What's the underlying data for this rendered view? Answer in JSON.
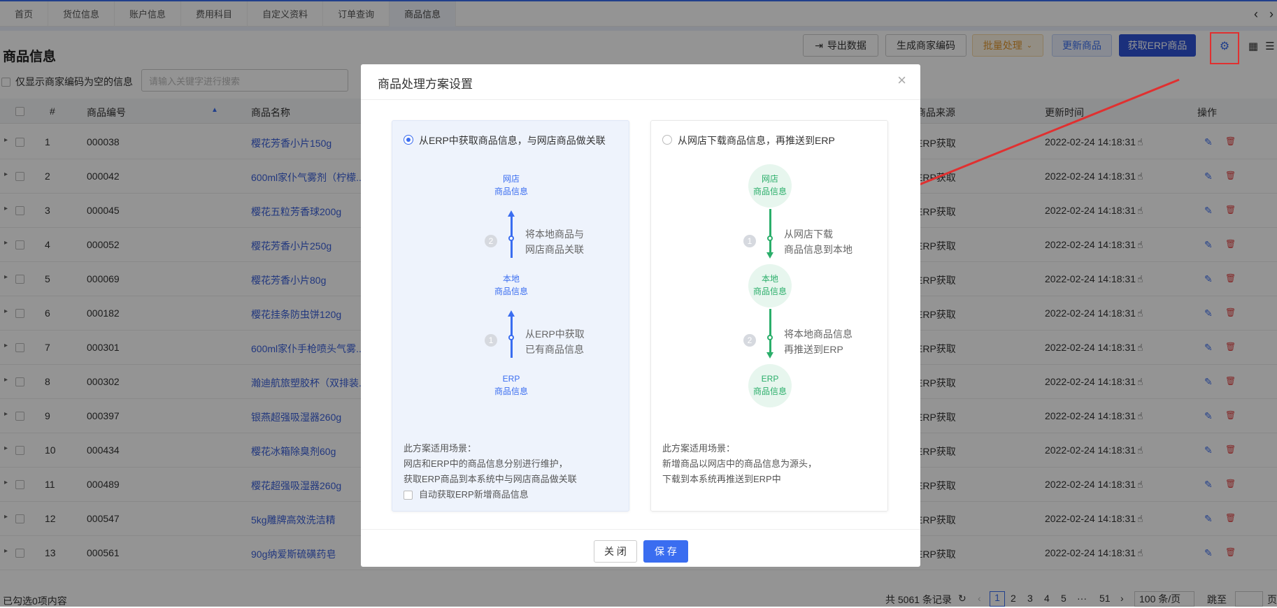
{
  "tabs": [
    "首页",
    "货位信息",
    "账户信息",
    "费用科目",
    "自定义资料",
    "订单查询",
    "商品信息"
  ],
  "active_tab": "商品信息",
  "page_title": "商品信息",
  "toolbar": {
    "export_label": "导出数据",
    "gen_code_label": "生成商家编码",
    "batch_label": "批量处理",
    "update_label": "更新商品",
    "fetch_erp_label": "获取ERP商品"
  },
  "filter": {
    "only_empty_label": "仅显示商家编码为空的信息",
    "search_placeholder": "请输入关键字进行搜索"
  },
  "table": {
    "headers": {
      "no": "#",
      "code": "商品编号",
      "name": "商品名称",
      "source": "商品来源",
      "time": "更新时间",
      "ops": "操作"
    },
    "rows": [
      {
        "no": "1",
        "code": "000038",
        "name": "樱花芳香小片150g",
        "source": "ERP获取",
        "time": "2022-02-24 14:18:31"
      },
      {
        "no": "2",
        "code": "000042",
        "name": "600ml家仆气雾剂（柠檬...",
        "source": "ERP获取",
        "time": "2022-02-24 14:18:31"
      },
      {
        "no": "3",
        "code": "000045",
        "name": "樱花五粒芳香球200g",
        "source": "ERP获取",
        "time": "2022-02-24 14:18:31"
      },
      {
        "no": "4",
        "code": "000052",
        "name": "樱花芳香小片250g",
        "source": "ERP获取",
        "time": "2022-02-24 14:18:31"
      },
      {
        "no": "5",
        "code": "000069",
        "name": "樱花芳香小片80g",
        "source": "ERP获取",
        "time": "2022-02-24 14:18:31"
      },
      {
        "no": "6",
        "code": "000182",
        "name": "樱花挂条防虫饼120g",
        "source": "ERP获取",
        "time": "2022-02-24 14:18:31"
      },
      {
        "no": "7",
        "code": "000301",
        "name": "600ml家仆手枪喷头气雾...",
        "source": "ERP获取",
        "time": "2022-02-24 14:18:31"
      },
      {
        "no": "8",
        "code": "000302",
        "name": "瀚迪航旅塑胶杯（双排装...",
        "source": "ERP获取",
        "time": "2022-02-24 14:18:31"
      },
      {
        "no": "9",
        "code": "000397",
        "name": "银燕超强吸湿器260g",
        "source": "ERP获取",
        "time": "2022-02-24 14:18:31"
      },
      {
        "no": "10",
        "code": "000434",
        "name": "樱花冰箱除臭剂60g",
        "source": "ERP获取",
        "time": "2022-02-24 14:18:31"
      },
      {
        "no": "11",
        "code": "000489",
        "name": "樱花超强吸湿器260g",
        "source": "ERP获取",
        "time": "2022-02-24 14:18:31"
      },
      {
        "no": "12",
        "code": "000547",
        "name": "5kg雕牌高效洗洁精",
        "source": "ERP获取",
        "time": "2022-02-24 14:18:31"
      },
      {
        "no": "13",
        "code": "000561",
        "name": "90g纳爱斯硫磺药皂",
        "source": "ERP获取",
        "time": "2022-02-24 14:18:31"
      }
    ]
  },
  "footer": {
    "selected": "已勾选0项内容",
    "total": "共 5061 条记录",
    "pages": [
      "1",
      "2",
      "3",
      "4",
      "5",
      "···",
      "51"
    ],
    "page_size": "100 条/页",
    "jump": "跳至",
    "page_unit": "页"
  },
  "modal": {
    "title": "商品处理方案设置",
    "option1": {
      "label": "从ERP中获取商品信息，与网店商品做关联",
      "node_top": [
        "网店",
        "商品信息"
      ],
      "node_mid": [
        "本地",
        "商品信息"
      ],
      "node_bot": [
        "ERP",
        "商品信息"
      ],
      "step2": "将本地商品与\n网店商品关联",
      "step1": "从ERP中获取\n已有商品信息",
      "desc_title": "此方案适用场景：",
      "desc1": "网店和ERP中的商品信息分别进行维护，",
      "desc2": "获取ERP商品到本系统中与网店商品做关联",
      "auto_label": "自动获取ERP新增商品信息"
    },
    "option2": {
      "label": "从网店下载商品信息，再推送到ERP",
      "node_top": [
        "网店",
        "商品信息"
      ],
      "node_mid": [
        "本地",
        "商品信息"
      ],
      "node_bot": [
        "ERP",
        "商品信息"
      ],
      "step1": "从网店下载\n商品信息到本地",
      "step2": "将本地商品信息\n再推送到ERP",
      "desc_title": "此方案适用场景：",
      "desc1": "新增商品以网店中的商品信息为源头，",
      "desc2": "下载到本系统再推送到ERP中"
    },
    "close_label": "关 闭",
    "save_label": "保 存"
  },
  "colors": {
    "accent": "#3a6df0",
    "green": "#2aae6a",
    "annotation": "#e03030"
  }
}
